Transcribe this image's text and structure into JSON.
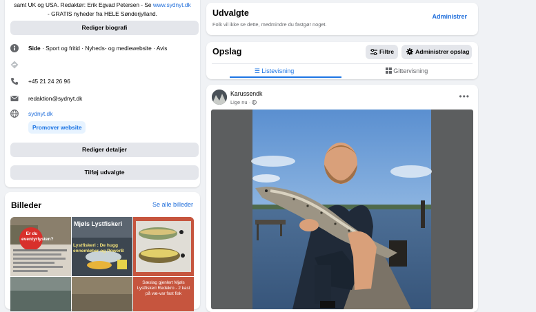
{
  "intro": {
    "bio_line1": "samt UK og USA. Redaktør: Erik Egvad Petersen - Se ",
    "bio_link": "www.sydnyt.dk",
    "bio_line2": "- GRATIS nyheder fra HELE Sønderjylland.",
    "edit_bio_button": "Rediger biografi",
    "page_label": "Side",
    "page_categories": " · Sport og fritid · Nyheds- og mediewebsite · Avis",
    "phone": "+45 21 24 26 96",
    "email": "redaktion@sydnyt.dk",
    "website": "sydnyt.dk",
    "promote_button": "Promover website",
    "edit_details_button": "Rediger detaljer",
    "add_featured_button": "Tilføj udvalgte"
  },
  "photos": {
    "title": "Billeder",
    "see_all": "Se alle billeder",
    "thumb1_text": "Er du eventyrlysten?",
    "thumb2_title": "Mjøls Lystfiskeri",
    "thumb2_sub": "Lystfiskeri : De hugg ennemløber og PowerB",
    "thumb6_text": "Sæslag gjenlert Mjøls Lystfiskeri Redekro - 2 kast på væ-var fast fisk"
  },
  "featured": {
    "title": "Udvalgte",
    "subtitle": "Folk vil ikke se dette, medmindre du fastgør noget.",
    "manage": "Administrer"
  },
  "posts": {
    "title": "Opslag",
    "filter_button": "Filtre",
    "manage_posts_button": "Administrer opslag",
    "tab_list": "Listevisning",
    "tab_grid": "Gittervisning"
  },
  "post": {
    "author": "Karussendk",
    "time": "Lige nu · ",
    "menu": "•••"
  },
  "colors": {
    "accent": "#1b74e4",
    "link": "#216fdb",
    "background": "#f0f2f5",
    "button_grey": "#e4e6eb"
  }
}
